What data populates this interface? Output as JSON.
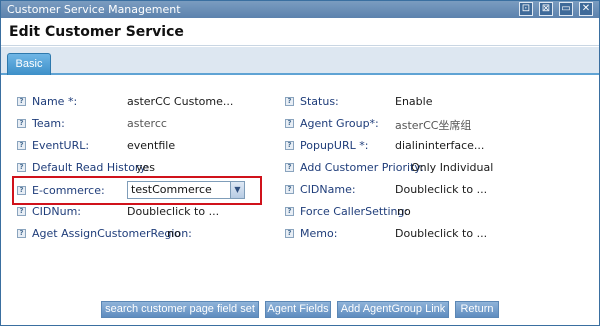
{
  "window": {
    "title": "Customer Service Management",
    "buttons": [
      "⊡",
      "⊠",
      "▭",
      "✕"
    ]
  },
  "header": {
    "title": "Edit Customer Service"
  },
  "tabs": [
    {
      "label": "Basic"
    }
  ],
  "fields_left": [
    {
      "label": "Name *:",
      "value": "asterCC Custome..."
    },
    {
      "label": "Team:",
      "value": "astercc"
    },
    {
      "label": "EventURL:",
      "value": "eventfile"
    },
    {
      "label": "Default Read History:",
      "value": "yes"
    },
    {
      "label": "E-commerce:",
      "value": "testCommerce"
    },
    {
      "label": "CIDNum:",
      "value": "Doubleclick to ..."
    },
    {
      "label": "Aget AssignCustomerRegion:",
      "value": "no"
    }
  ],
  "fields_right": [
    {
      "label": "Status:",
      "value": "Enable"
    },
    {
      "label": "Agent Group*:",
      "value": "asterCC坐席组"
    },
    {
      "label": "PopupURL *:",
      "value": "dialininterface..."
    },
    {
      "label": "Add Customer Priority:",
      "value": "Only Individual"
    },
    {
      "label": "CIDName:",
      "value": "Doubleclick to ..."
    },
    {
      "label": "Force CallerSetting:",
      "value": "no"
    },
    {
      "label": "Memo:",
      "value": "Doubleclick to ..."
    }
  ],
  "footer": {
    "buttons": [
      "search customer page field set",
      "Agent Fields",
      "Add AgentGroup Link",
      "Return"
    ]
  },
  "colors": {
    "accent": "#3d8fc8",
    "highlight": "#d0121b",
    "titlebar": "#5c82ad"
  },
  "icons": {
    "help": "help-icon",
    "dropdown": "chevron-down-icon"
  }
}
